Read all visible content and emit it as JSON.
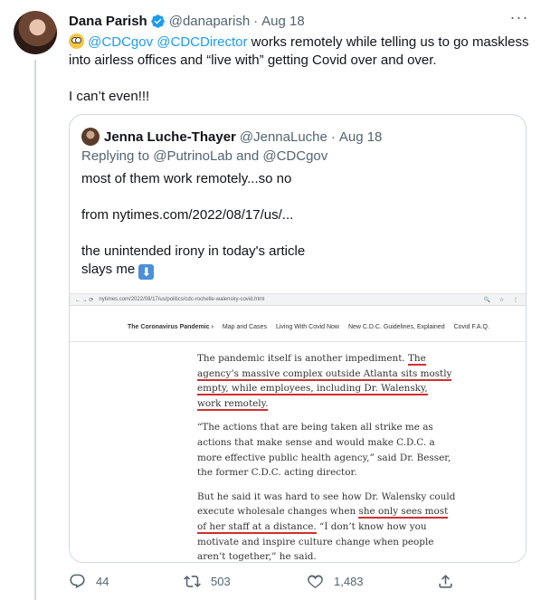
{
  "tweet": {
    "author": "Dana Parish",
    "handle": "@danaparish",
    "separator": "·",
    "date": "Aug 18",
    "emoji": "flushed-face",
    "mention1": "@CDCgov",
    "mention2": "@CDCDirector",
    "text_line1": " works remotely while telling us to go maskless",
    "text_line2": "into airless offices and “live with” getting Covid over and over.",
    "text_line3": "I can’t even!!!"
  },
  "quote": {
    "author": "Jenna Luche-Thayer",
    "handle": "@JennaLuche",
    "separator": "·",
    "date": "Aug 18",
    "reply": "Replying to @PutrinoLab and @CDCgov",
    "line1": "most of them work remotely...so no",
    "line2": "from nytimes.com/2022/08/17/us/...",
    "line3": "the unintended irony in today's article",
    "line4": "slays me",
    "emoji": "down-arrow"
  },
  "screenshot": {
    "url": "nytimes.com/2022/08/17/us/politics/cdc-rochelle-walensky-covid.html",
    "nav": [
      "The Coronavirus Pandemic ›",
      "Map and Cases",
      "Living With Covid Now",
      "New C.D.C. Guidelines, Explained",
      "Covid F.A.Q."
    ],
    "p1": {
      "a": "The pandemic itself is another impediment. ",
      "b": "The",
      "c": "agency’s massive complex outside Atlanta sits mostly",
      "d": "empty, while employees, including Dr. Walensky,",
      "e": "work remotely."
    },
    "p2": {
      "a": "“The actions that are being taken all strike me as",
      "b": "actions that make sense and would make C.D.C. a",
      "c": "more effective public health agency,” said Dr. Besser,",
      "d": "the former C.D.C. acting director."
    },
    "p3": {
      "a": "But he said it was hard to see how Dr. Walensky could",
      "b1": "execute wholesale changes when ",
      "b2": "she only sees most",
      "c1": "of her staff at a distance.",
      "c2": " “I don’t know how you",
      "d": "motivate and inspire culture change when people",
      "e": "aren’t together,” he said."
    }
  },
  "actions": {
    "replies": "44",
    "retweets": "503",
    "likes": "1,483"
  },
  "colors": {
    "accent": "#1d9bf0",
    "secondary_text": "#536471",
    "underline": "#d32f2f"
  }
}
